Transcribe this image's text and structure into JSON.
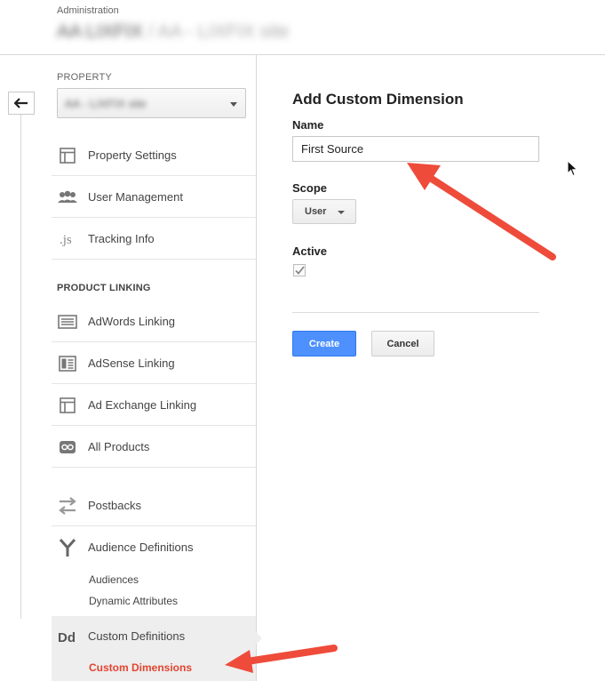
{
  "header": {
    "breadcrumb_label": "Administration",
    "account_name": "AA LIXFIX",
    "account_sub": " / AA - LIXFIX site"
  },
  "sidebar": {
    "property_label": "PROPERTY",
    "property_value": "AA - LIXFIX site",
    "items": [
      {
        "label": "Property Settings",
        "icon": "property-settings-icon"
      },
      {
        "label": "User Management",
        "icon": "users-icon"
      },
      {
        "label": "Tracking Info",
        "icon": "js-icon"
      }
    ],
    "product_linking_label": "PRODUCT LINKING",
    "linking_items": [
      {
        "label": "AdWords Linking",
        "icon": "adwords-icon"
      },
      {
        "label": "AdSense Linking",
        "icon": "adsense-icon"
      },
      {
        "label": "Ad Exchange Linking",
        "icon": "ad-exchange-icon"
      },
      {
        "label": "All Products",
        "icon": "link-icon"
      }
    ],
    "postbacks_label": "Postbacks",
    "audience_definitions_label": "Audience Definitions",
    "audience_sub": [
      "Audiences",
      "Dynamic Attributes"
    ],
    "custom_definitions_label": "Custom Definitions",
    "custom_sub_active": "Custom Dimensions"
  },
  "form": {
    "title": "Add Custom Dimension",
    "name_label": "Name",
    "name_value": "First Source",
    "scope_label": "Scope",
    "scope_value": "User",
    "active_label": "Active",
    "active_checked": true,
    "create_label": "Create",
    "cancel_label": "Cancel"
  },
  "colors": {
    "accent_blue": "#4d90fe",
    "active_link": "#e2442f",
    "annotation_arrow": "#ee4b3b"
  }
}
